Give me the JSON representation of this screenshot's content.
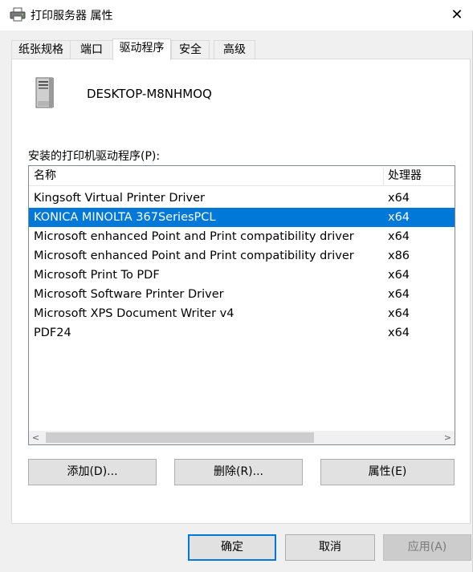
{
  "window": {
    "title": "打印服务器 属性",
    "close_glyph": "✕"
  },
  "tabs": [
    {
      "label": "纸张规格"
    },
    {
      "label": "端口"
    },
    {
      "label": "驱动程序",
      "active": true
    },
    {
      "label": "安全"
    },
    {
      "label": "高级"
    }
  ],
  "server": {
    "icon": "server-tower-icon",
    "name": "DESKTOP-M8NHMOQ"
  },
  "drivers": {
    "label": "安装的打印机驱动程序(P):",
    "columns": {
      "name": "名称",
      "processor": "处理器"
    },
    "rows": [
      {
        "name": "Kingsoft Virtual Printer Driver",
        "processor": "x64"
      },
      {
        "name": "KONICA MINOLTA 367SeriesPCL",
        "processor": "x64",
        "selected": true
      },
      {
        "name": "Microsoft enhanced Point and Print compatibility driver",
        "processor": "x64"
      },
      {
        "name": "Microsoft enhanced Point and Print compatibility driver",
        "processor": "x86"
      },
      {
        "name": "Microsoft Print To PDF",
        "processor": "x64"
      },
      {
        "name": "Microsoft Software Printer Driver",
        "processor": "x64"
      },
      {
        "name": "Microsoft XPS Document Writer v4",
        "processor": "x64"
      },
      {
        "name": "PDF24",
        "processor": "x64"
      }
    ],
    "scroll_left_glyph": "<",
    "scroll_right_glyph": ">"
  },
  "actions": {
    "add": "添加(D)...",
    "remove": "删除(R)...",
    "properties": "属性(E)"
  },
  "footer": {
    "ok": "确定",
    "cancel": "取消",
    "apply": "应用(A)"
  },
  "colors": {
    "selection": "#0078d7",
    "default_button_border": "#0078d7"
  }
}
